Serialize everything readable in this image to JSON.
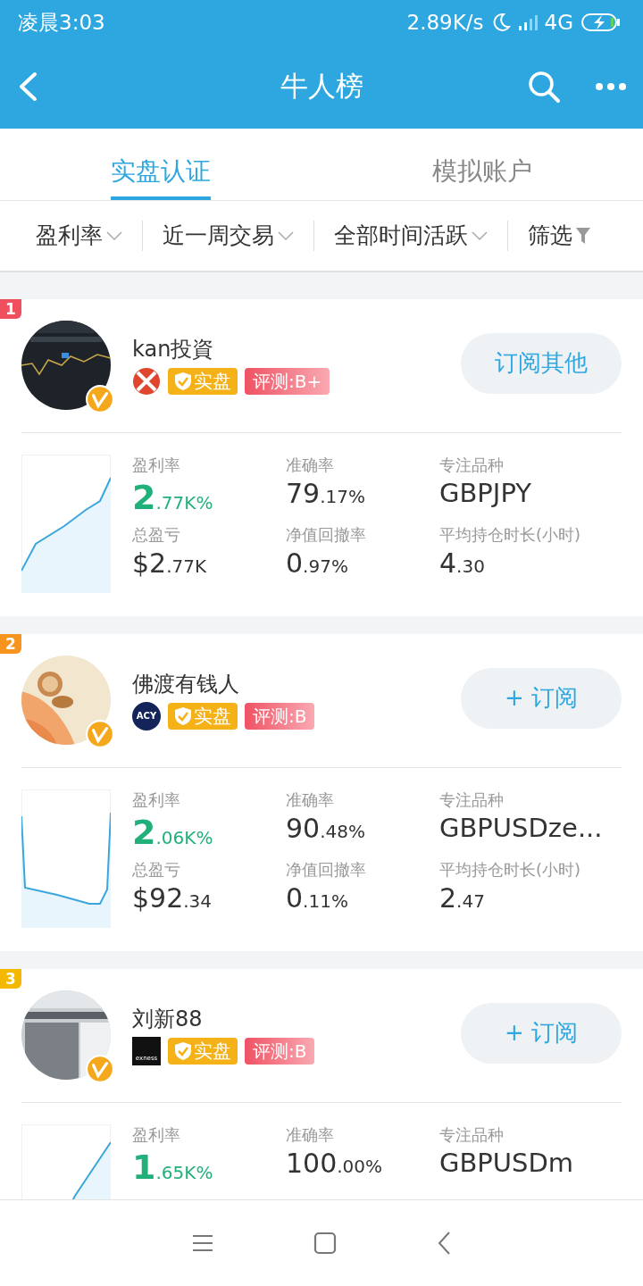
{
  "status_bar": {
    "time": "凌晨3:03",
    "speed": "2.89K/s",
    "network": "4G"
  },
  "header": {
    "title": "牛人榜"
  },
  "tabs": [
    {
      "label": "实盘认证",
      "selected": true
    },
    {
      "label": "模拟账户",
      "selected": false
    }
  ],
  "filters": [
    {
      "label": "盈利率",
      "kind": "dropdown"
    },
    {
      "label": "近一周交易",
      "kind": "dropdown"
    },
    {
      "label": "全部时间活跃",
      "kind": "dropdown"
    },
    {
      "label": "筛选",
      "kind": "filter"
    }
  ],
  "traders": [
    {
      "rank": "1",
      "color": "#f0505e",
      "name": "kan投資",
      "broker": {
        "kind": "ball"
      },
      "verified_label": "实盘",
      "rating": "评测:B+",
      "button": "订阅其他",
      "stats": [
        {
          "label": "盈利率",
          "value": "2.77K%",
          "kind": "profit"
        },
        {
          "label": "准确率",
          "value": "79.17%",
          "kind": "plain"
        },
        {
          "label": "专注品种",
          "value": "GBPJPY",
          "kind": "text"
        },
        {
          "label": "总盈亏",
          "value": "$2.77K",
          "kind": "plain"
        },
        {
          "label": "净值回撤率",
          "value": "0.97%",
          "kind": "plain"
        },
        {
          "label": "平均持仓时长(小时)",
          "value": "4.30",
          "kind": "plain"
        }
      ]
    },
    {
      "rank": "2",
      "color": "#f7941d",
      "name": "佛渡有钱人",
      "broker": {
        "kind": "acy",
        "label": "ACY"
      },
      "verified_label": "实盘",
      "rating": "评测:B",
      "button": "+ 订阅",
      "stats": [
        {
          "label": "盈利率",
          "value": "2.06K%",
          "kind": "profit"
        },
        {
          "label": "准确率",
          "value": "90.48%",
          "kind": "plain"
        },
        {
          "label": "专注品种",
          "value": "GBPUSDze...",
          "kind": "text"
        },
        {
          "label": "总盈亏",
          "value": "$92.34",
          "kind": "plain"
        },
        {
          "label": "净值回撤率",
          "value": "0.11%",
          "kind": "plain"
        },
        {
          "label": "平均持仓时长(小时)",
          "value": "2.47",
          "kind": "plain"
        }
      ]
    },
    {
      "rank": "3",
      "color": "#f5b800",
      "name": "刘新88",
      "broker": {
        "kind": "exness",
        "label": "exness"
      },
      "verified_label": "实盘",
      "rating": "评测:B",
      "button": "+ 订阅",
      "stats": [
        {
          "label": "盈利率",
          "value": "1.65K%",
          "kind": "profit"
        },
        {
          "label": "准确率",
          "value": "100.00%",
          "kind": "plain"
        },
        {
          "label": "专注品种",
          "value": "GBPUSDm",
          "kind": "text"
        }
      ]
    }
  ]
}
